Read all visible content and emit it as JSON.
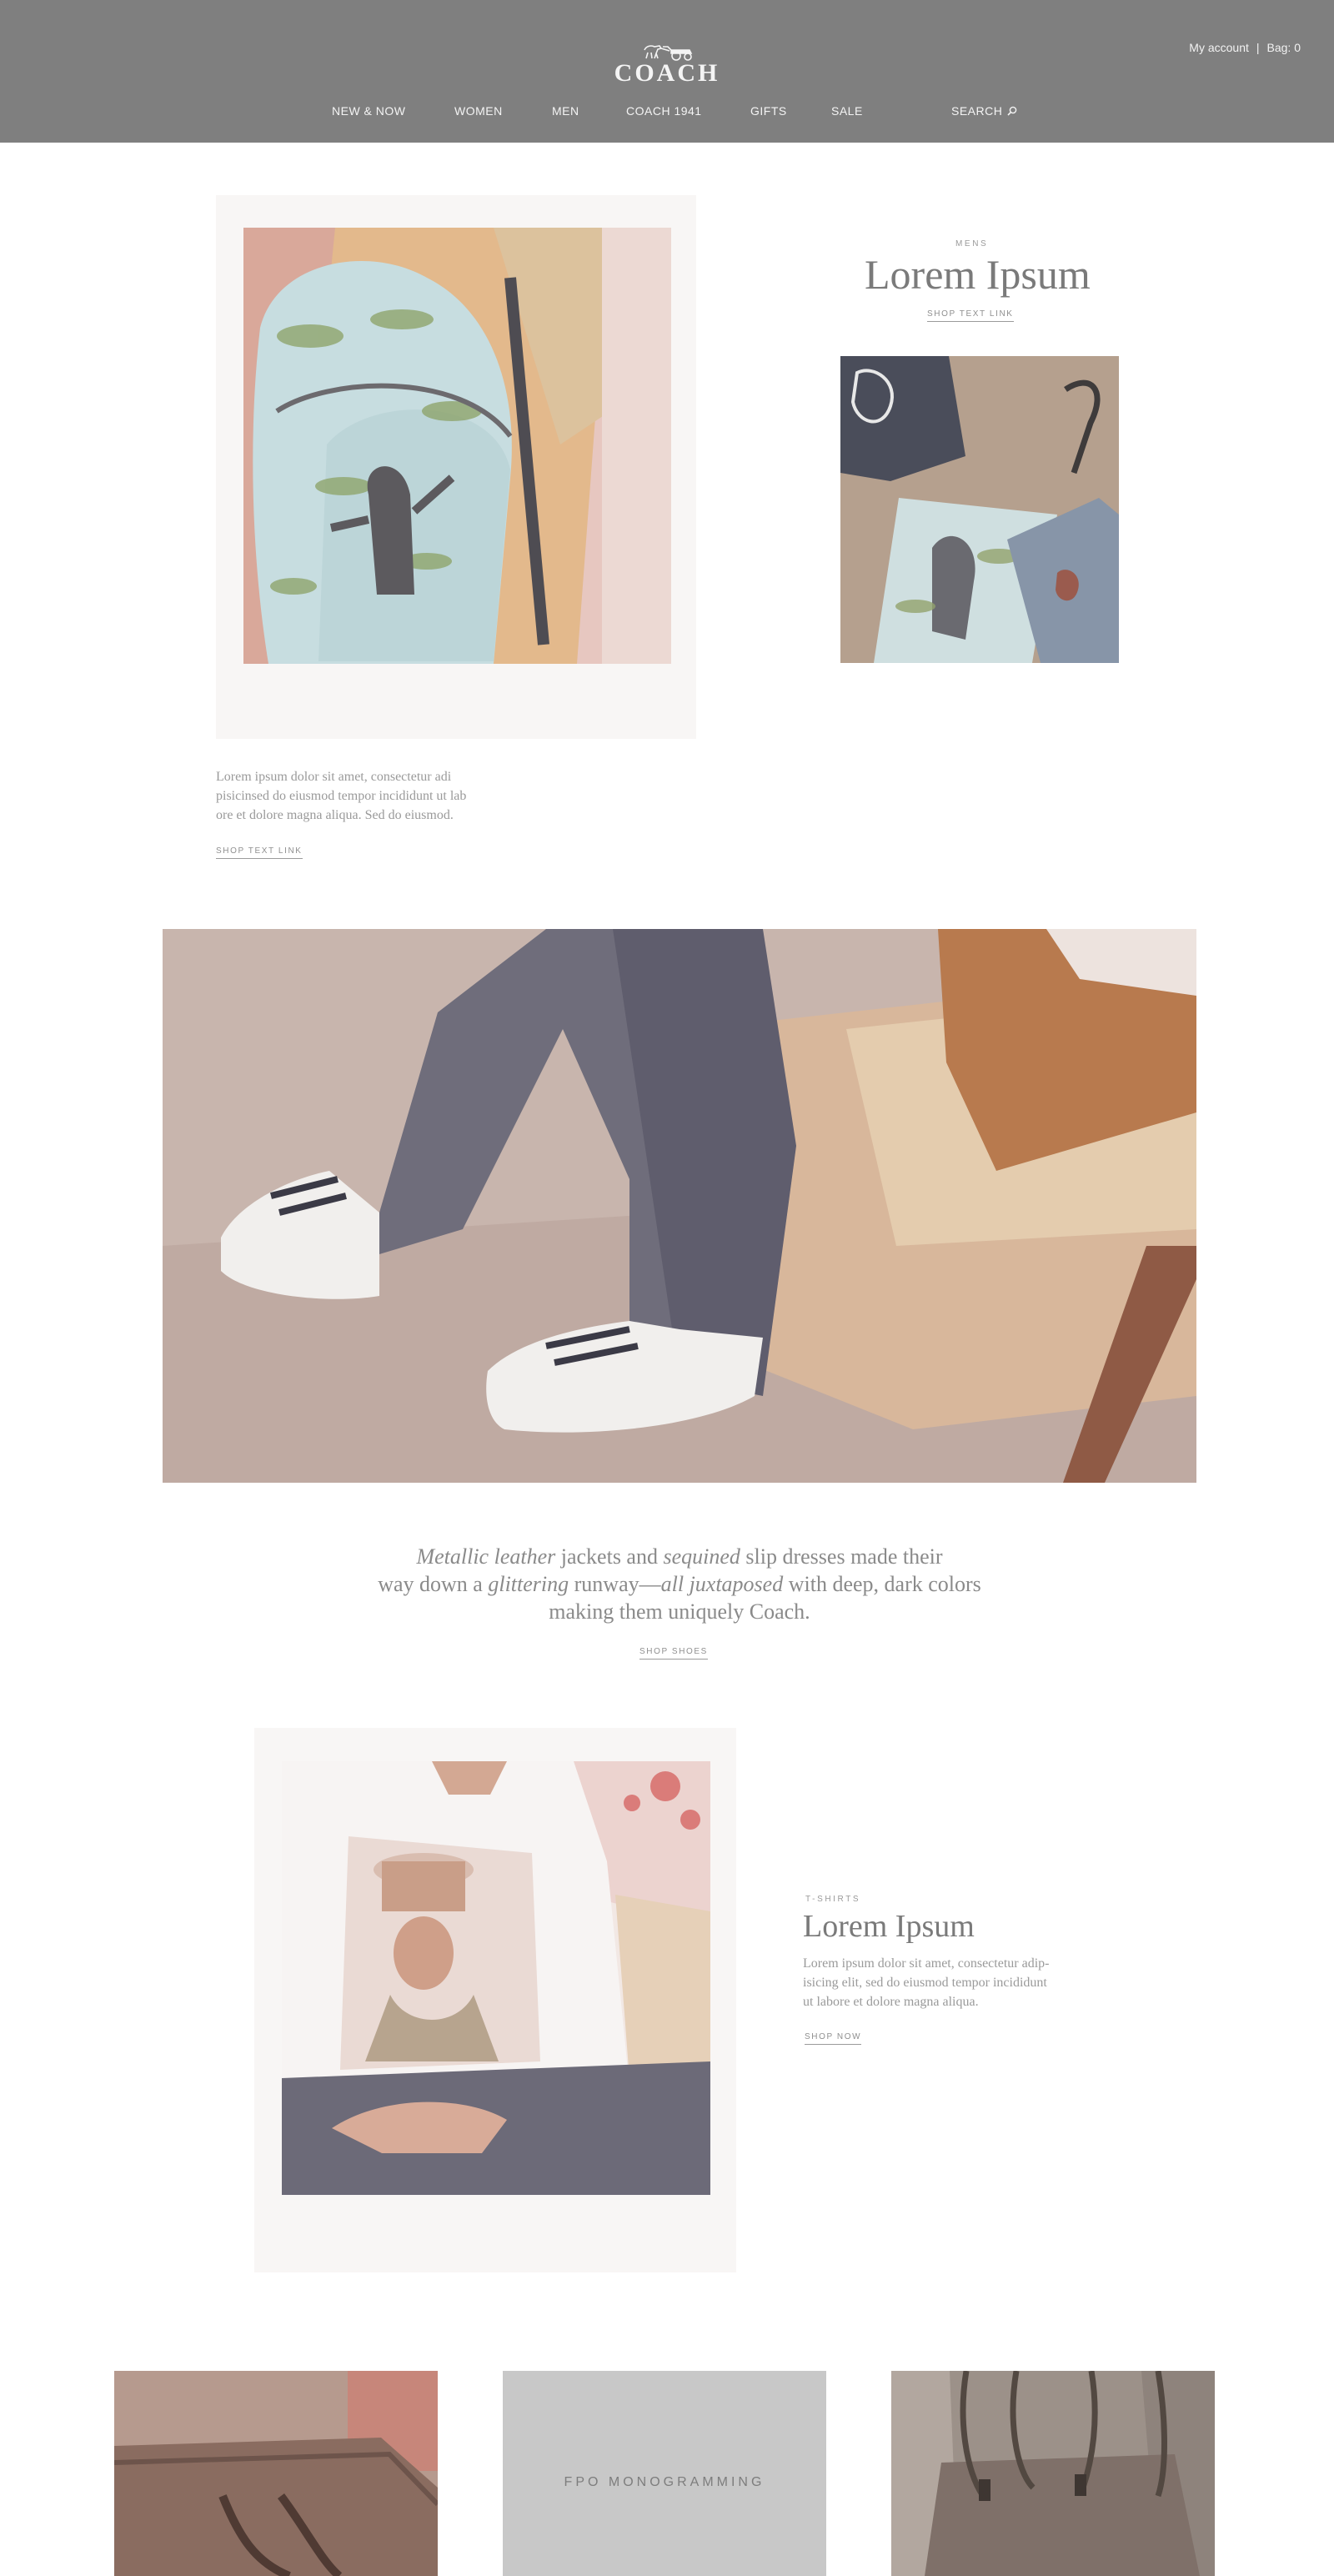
{
  "header": {
    "brand": "COACH",
    "util": {
      "account": "My account",
      "separator": "|",
      "bag": "Bag: 0"
    },
    "nav": [
      {
        "label": "NEW & NOW"
      },
      {
        "label": "WOMEN"
      },
      {
        "label": "MEN"
      },
      {
        "label": "COACH 1941"
      },
      {
        "label": "GIFTS"
      },
      {
        "label": "SALE"
      }
    ],
    "search_label": "SEARCH"
  },
  "section_backpack": {
    "eyebrow": "MENS",
    "title": "Lorem Ipsum",
    "title_link": "SHOP TEXT LINK",
    "body_lines": [
      "Lorem ipsum dolor sit amet, consectetur adi",
      "pisicinsed do eiusmod tempor incididunt ut lab",
      "ore et dolore magna aliqua. Sed do eiusmod."
    ],
    "body_link": "SHOP TEXT LINK"
  },
  "quote": {
    "parts": [
      {
        "text": "Metallic leather",
        "italic": true
      },
      {
        "text": " jackets and ",
        "italic": false
      },
      {
        "text": "sequined",
        "italic": true
      },
      {
        "text": " slip dresses made their",
        "italic": false
      },
      {
        "text": "\n",
        "italic": false
      },
      {
        "text": "way down a ",
        "italic": false
      },
      {
        "text": "glittering",
        "italic": true
      },
      {
        "text": " runway—",
        "italic": false
      },
      {
        "text": "all juxtaposed",
        "italic": true
      },
      {
        "text": " with deep, dark colors",
        "italic": false
      },
      {
        "text": "\n",
        "italic": false
      },
      {
        "text": "making them uniquely Coach.",
        "italic": false
      }
    ],
    "link": "SHOP SHOES"
  },
  "section_tshirts": {
    "eyebrow": "T-SHIRTS",
    "title": "Lorem Ipsum",
    "body_lines": [
      "Lorem ipsum dolor sit amet, consectetur adip-",
      "isicing elit, sed do eiusmod tempor incididunt",
      "ut labore et dolore magna aliqua."
    ],
    "link": "SHOP NOW"
  },
  "cards": {
    "fpo_label": "FPO MONOGRAMMING"
  },
  "colors": {
    "header_bg": "#7f7f7f",
    "header_text": "#f4f4f4",
    "fpo_bg": "#c8c8c8"
  },
  "icons": {
    "search": "magnifier-icon",
    "logo": "horse-carriage-icon"
  }
}
